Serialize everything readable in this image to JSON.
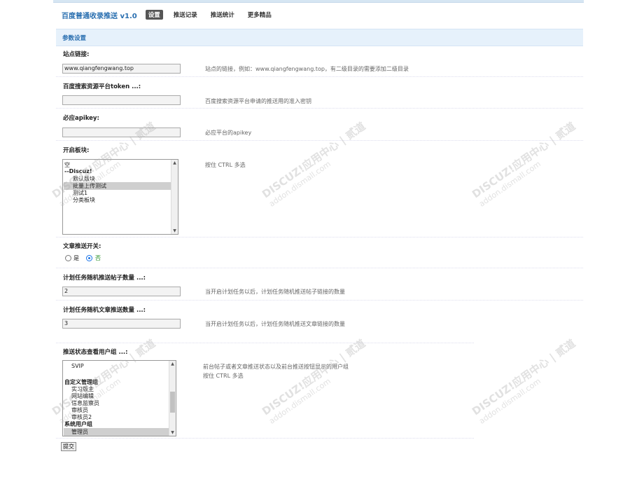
{
  "header": {
    "title": "百度普通收录推送 v1.0",
    "nav": [
      "设置",
      "推送记录",
      "推送统计",
      "更多精品"
    ]
  },
  "section_title": "参数设置",
  "fields": {
    "site": {
      "label": "站点链接:",
      "value": "www.qiangfengwang.top",
      "hint": "站点的链接，例如：www.qiangfengwang.top，有二级目录的需要添加二级目录"
    },
    "token": {
      "label": "百度搜索资源平台token ...:",
      "value": "",
      "hint": "百度搜索资源平台申请的推送用的准入密钥"
    },
    "apikey": {
      "label": "必应apikey:",
      "value": "",
      "hint": "必应平台的apikey"
    },
    "boards": {
      "label": "开启板块:",
      "hint": "按住 CTRL 多选",
      "options": [
        "空",
        "--Discuz!",
        "默认版块",
        "批量上传测试",
        "测试1",
        "分类板块"
      ]
    },
    "article_switch": {
      "label": "文章推送开关:",
      "yes": "是",
      "no": "否"
    },
    "post_count": {
      "label": "计划任务随机推送帖子数量 ...:",
      "value": "2",
      "hint": "当开启计划任务以后，计划任务随机推送帖子链接的数量"
    },
    "article_count": {
      "label": "计划任务随机文章推送数量 ...:",
      "value": "3",
      "hint": "当开启计划任务以后，计划任务随机推送文章链接的数量"
    },
    "groups": {
      "label": "推送状态查看用户组 ...:",
      "hint1": "前台帖子或者文章推送状态以及前台推送按钮显示的用户组",
      "hint2": "按住 CTRL 多选",
      "options": [
        "SVIP",
        "",
        "自定义管理组",
        "实习版主",
        "网站编辑",
        "信息监察员",
        "审核员",
        "审核员2",
        "系统用户组",
        "管理员"
      ]
    }
  },
  "submit_label": "提交",
  "watermark": {
    "brand": "DISCUZ!应用中心 | 贰道",
    "domain": "addon.dismall.com"
  },
  "colors": {
    "accent": "#2a6fb0",
    "section_bg": "#e6f1fb",
    "radio_checked": "#1a73e8"
  }
}
